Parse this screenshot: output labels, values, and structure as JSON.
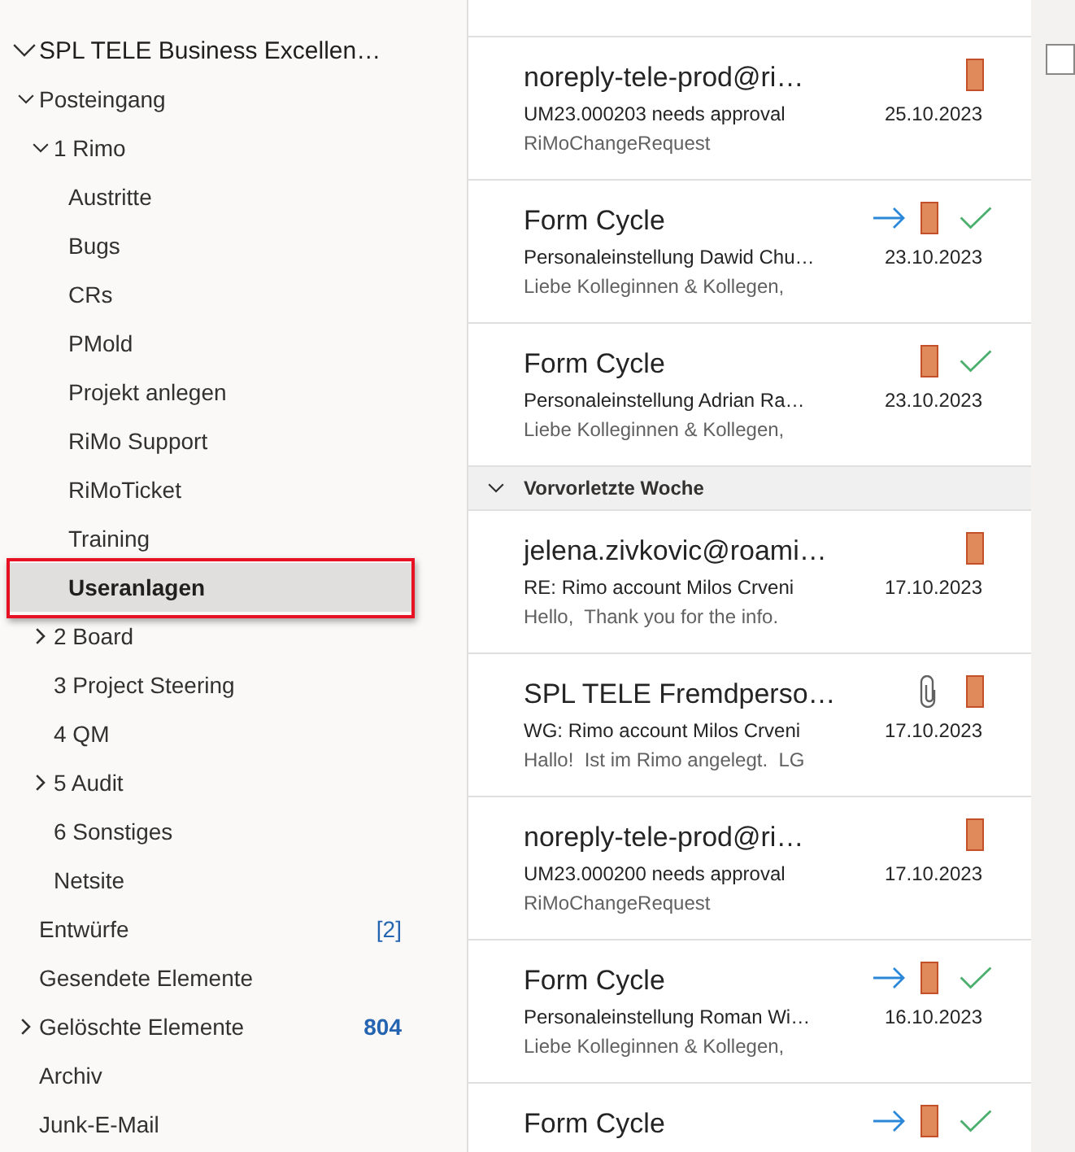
{
  "folders": [
    {
      "label": "SPL TELE Business Excellen…",
      "kind": "account",
      "expandable": true,
      "expanded": true,
      "selected": false,
      "highlighted": false,
      "children": [
        {
          "label": "Posteingang",
          "kind": "folder",
          "expandable": true,
          "expanded": true,
          "selected": false,
          "highlighted": false,
          "children": [
            {
              "label": "1 Rimo",
              "kind": "folder",
              "expandable": true,
              "expanded": true,
              "selected": false,
              "highlighted": false,
              "children": [
                {
                  "label": "Austritte",
                  "kind": "folder",
                  "expandable": false,
                  "selected": false,
                  "highlighted": false
                },
                {
                  "label": "Bugs",
                  "kind": "folder",
                  "expandable": false,
                  "selected": false,
                  "highlighted": false
                },
                {
                  "label": "CRs",
                  "kind": "folder",
                  "expandable": false,
                  "selected": false,
                  "highlighted": false
                },
                {
                  "label": "PMold",
                  "kind": "folder",
                  "expandable": false,
                  "selected": false,
                  "highlighted": false
                },
                {
                  "label": "Projekt anlegen",
                  "kind": "folder",
                  "expandable": false,
                  "selected": false,
                  "highlighted": false
                },
                {
                  "label": "RiMo Support",
                  "kind": "folder",
                  "expandable": false,
                  "selected": false,
                  "highlighted": false
                },
                {
                  "label": "RiMoTicket",
                  "kind": "folder",
                  "expandable": false,
                  "selected": false,
                  "highlighted": false
                },
                {
                  "label": "Training",
                  "kind": "folder",
                  "expandable": false,
                  "selected": false,
                  "highlighted": false
                },
                {
                  "label": "Useranlagen",
                  "kind": "folder",
                  "expandable": false,
                  "selected": true,
                  "highlighted": true
                }
              ]
            },
            {
              "label": "2 Board",
              "kind": "folder",
              "expandable": true,
              "expanded": false,
              "selected": false,
              "highlighted": false
            },
            {
              "label": "3 Project Steering",
              "kind": "folder",
              "expandable": false,
              "selected": false,
              "highlighted": false
            },
            {
              "label": "4 QM",
              "kind": "folder",
              "expandable": false,
              "selected": false,
              "highlighted": false
            },
            {
              "label": "5 Audit",
              "kind": "folder",
              "expandable": true,
              "expanded": false,
              "selected": false,
              "highlighted": false
            },
            {
              "label": "6 Sonstiges",
              "kind": "folder",
              "expandable": false,
              "selected": false,
              "highlighted": false
            },
            {
              "label": "Netsite",
              "kind": "folder",
              "expandable": false,
              "selected": false,
              "highlighted": false
            }
          ]
        },
        {
          "label": "Entwürfe",
          "kind": "folder",
          "expandable": false,
          "selected": false,
          "highlighted": false,
          "badge": {
            "text": "[2]",
            "kind": "total"
          }
        },
        {
          "label": "Gesendete Elemente",
          "kind": "folder",
          "expandable": false,
          "selected": false,
          "highlighted": false
        },
        {
          "label": "Gelöschte Elemente",
          "kind": "folder",
          "expandable": true,
          "expanded": false,
          "selected": false,
          "highlighted": false,
          "badge": {
            "text": "804",
            "kind": "unread"
          }
        },
        {
          "label": "Archiv",
          "kind": "folder",
          "expandable": false,
          "selected": false,
          "highlighted": false
        },
        {
          "label": "Junk-E-Mail",
          "kind": "folder",
          "expandable": false,
          "selected": false,
          "highlighted": false
        }
      ]
    }
  ],
  "messages": [
    {
      "kind": "message",
      "sender": "noreply-tele-prod@ri…",
      "subject": "UM23.000203 needs approval",
      "preview": "RiMoChangeRequest",
      "date": "25.10.2023",
      "forwarded": false,
      "attachment": false,
      "categorized": true,
      "completed": false
    },
    {
      "kind": "message",
      "sender": "Form Cycle",
      "subject": "Personaleinstellung Dawid Chu…",
      "preview": "Liebe Kolleginnen & Kollegen,",
      "date": "23.10.2023",
      "forwarded": true,
      "attachment": false,
      "categorized": true,
      "completed": true
    },
    {
      "kind": "message",
      "sender": "Form Cycle",
      "subject": "Personaleinstellung Adrian Ra…",
      "preview": "Liebe Kolleginnen & Kollegen,",
      "date": "23.10.2023",
      "forwarded": false,
      "attachment": false,
      "categorized": true,
      "completed": true
    },
    {
      "kind": "group",
      "label": "Vorvorletzte Woche",
      "expanded": true
    },
    {
      "kind": "message",
      "sender": "jelena.zivkovic@roami…",
      "subject": "RE: Rimo account Milos Crveni",
      "preview": "Hello,  Thank you for the info.",
      "date": "17.10.2023",
      "forwarded": false,
      "attachment": false,
      "categorized": true,
      "completed": false
    },
    {
      "kind": "message",
      "sender": "SPL TELE Fremdperso…",
      "subject": "WG: Rimo account Milos Crveni",
      "preview": "Hallo!  Ist im Rimo angelegt.  LG",
      "date": "17.10.2023",
      "forwarded": false,
      "attachment": true,
      "categorized": true,
      "completed": false
    },
    {
      "kind": "message",
      "sender": "noreply-tele-prod@ri…",
      "subject": "UM23.000200 needs approval",
      "preview": "RiMoChangeRequest",
      "date": "17.10.2023",
      "forwarded": false,
      "attachment": false,
      "categorized": true,
      "completed": false
    },
    {
      "kind": "message",
      "sender": "Form Cycle",
      "subject": "Personaleinstellung Roman Wi…",
      "preview": "Liebe Kolleginnen & Kollegen,",
      "date": "16.10.2023",
      "forwarded": true,
      "attachment": false,
      "categorized": true,
      "completed": true
    },
    {
      "kind": "message",
      "sender": "Form Cycle",
      "forwarded": true,
      "attachment": false,
      "categorized": true,
      "completed": true
    }
  ]
}
